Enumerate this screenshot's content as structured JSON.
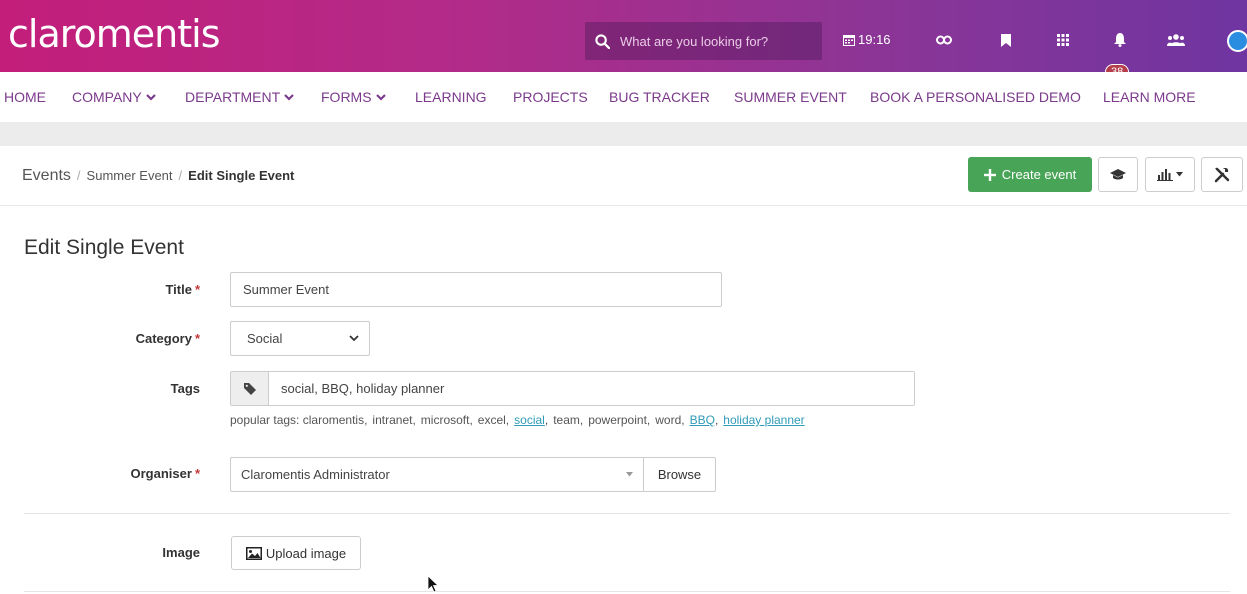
{
  "header": {
    "logo": "claromentis",
    "search_placeholder": "What are you looking for?",
    "time": "19:16",
    "notification_count": "38",
    "colors": {
      "gradient_start": "#c21e7a",
      "gradient_end": "#6f35a0"
    }
  },
  "nav": {
    "items": [
      {
        "label": "HOME",
        "dropdown": false
      },
      {
        "label": "COMPANY",
        "dropdown": true
      },
      {
        "label": "DEPARTMENT",
        "dropdown": true
      },
      {
        "label": "FORMS",
        "dropdown": true
      },
      {
        "label": "LEARNING",
        "dropdown": false
      },
      {
        "label": "PROJECTS",
        "dropdown": false
      },
      {
        "label": "BUG TRACKER",
        "dropdown": false
      },
      {
        "label": "SUMMER EVENT",
        "dropdown": false
      },
      {
        "label": "BOOK A PERSONALISED DEMO",
        "dropdown": false
      },
      {
        "label": "LEARN MORE",
        "dropdown": false
      }
    ]
  },
  "breadcrumb": {
    "items": [
      "Events",
      "Summer Event",
      "Edit Single Event"
    ],
    "separator": "/"
  },
  "toolbar": {
    "create_label": "Create event"
  },
  "form": {
    "heading": "Edit Single Event",
    "title_label": "Title",
    "title_value": "Summer Event",
    "category_label": "Category",
    "category_value": "Social",
    "tags_label": "Tags",
    "tags_value": "social, BBQ, holiday planner",
    "popular_prefix": "popular tags:",
    "popular_tags": [
      {
        "text": "claromentis,",
        "active": false
      },
      {
        "text": "intranet,",
        "active": false
      },
      {
        "text": "microsoft,",
        "active": false
      },
      {
        "text": "excel,",
        "active": false
      },
      {
        "text": "social",
        "active": true
      },
      {
        "text": ",",
        "active": false
      },
      {
        "text": "team,",
        "active": false
      },
      {
        "text": "powerpoint,",
        "active": false
      },
      {
        "text": "word,",
        "active": false
      },
      {
        "text": "BBQ",
        "active": true
      },
      {
        "text": ",",
        "active": false
      },
      {
        "text": "holiday planner",
        "active": true
      }
    ],
    "organiser_label": "Organiser",
    "organiser_value": "Claromentis Administrator",
    "browse_label": "Browse",
    "image_label": "Image",
    "upload_label": "Upload image",
    "required_mark": "*"
  }
}
